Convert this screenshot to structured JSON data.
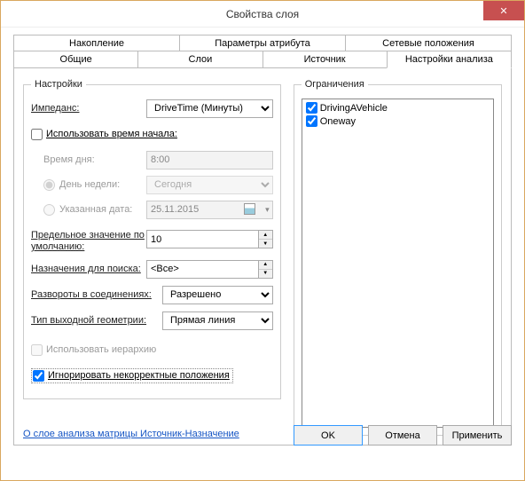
{
  "window": {
    "title": "Свойства слоя"
  },
  "tabs": {
    "top": [
      "Накопление",
      "Параметры атрибута",
      "Сетевые положения"
    ],
    "bottom": [
      "Общие",
      "Слои",
      "Источник",
      "Настройки анализа"
    ],
    "active": "Настройки анализа"
  },
  "settings": {
    "legend": "Настройки",
    "impedance": {
      "label": "Импеданс:",
      "value": "DriveTime (Минуты)"
    },
    "useStartTime": {
      "label": "Использовать время начала:",
      "checked": false
    },
    "timeOfDay": {
      "label": "Время дня:",
      "value": "8:00"
    },
    "dayOfWeek": {
      "label": "День недели:",
      "value": "Сегодня"
    },
    "specificDate": {
      "label": "Указанная дата:",
      "value": "25.11.2015"
    },
    "defaultCutoff": {
      "label": "Предельное значение по умолчанию:",
      "value": "10"
    },
    "destinationsToFind": {
      "label": "Назначения для поиска:",
      "value": "<Все>"
    },
    "uturns": {
      "label": "Развороты в соединениях:",
      "value": "Разрешено"
    },
    "outputGeom": {
      "label": "Тип выходной геометрии:",
      "value": "Прямая линия"
    },
    "useHierarchy": {
      "label": "Использовать иерархию",
      "checked": false,
      "enabled": false
    },
    "ignoreInvalid": {
      "label": "Игнорировать некорректные положения",
      "checked": true
    }
  },
  "restrictions": {
    "legend": "Ограничения",
    "items": [
      {
        "label": "DrivingAVehicle",
        "checked": true
      },
      {
        "label": "Oneway",
        "checked": true
      }
    ]
  },
  "link": "О слое анализа матрицы Источник-Назначение",
  "buttons": {
    "ok": "OK",
    "cancel": "Отмена",
    "apply": "Применить"
  }
}
